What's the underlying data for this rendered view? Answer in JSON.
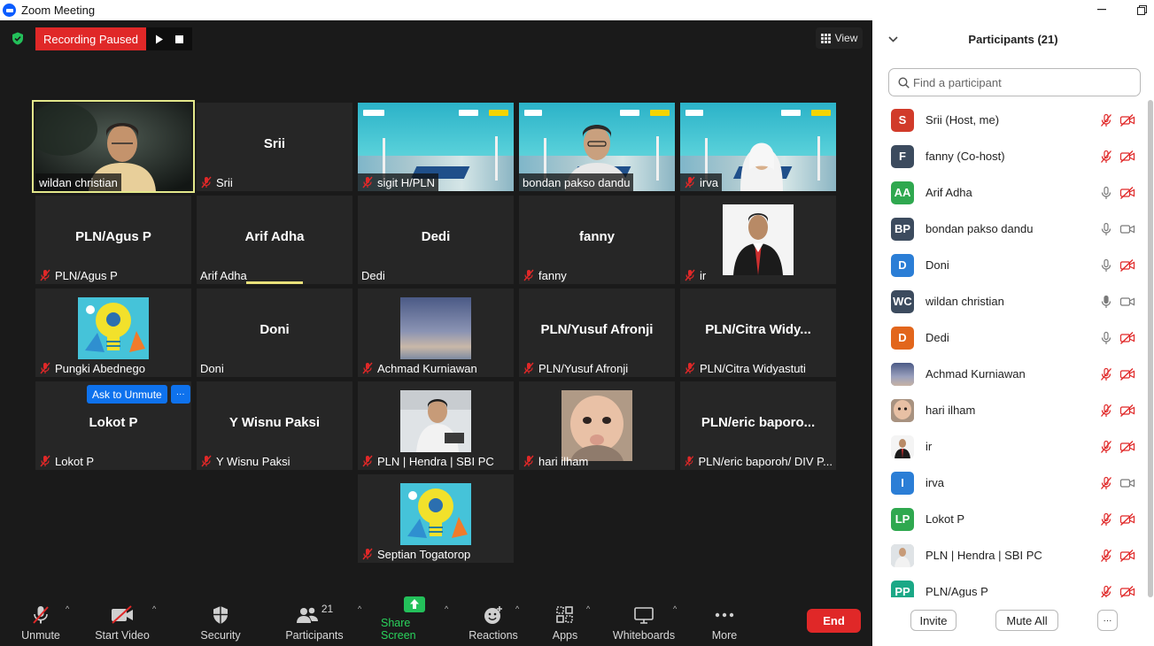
{
  "window": {
    "title": "Zoom Meeting"
  },
  "recording": {
    "label": "Recording Paused"
  },
  "view": {
    "label": "View"
  },
  "tiles": [
    {
      "name": "wildan christian",
      "muted": false,
      "kind": "video"
    },
    {
      "name": "Srii",
      "muted": true,
      "kind": "name",
      "center": "Srii"
    },
    {
      "name": "sigit H/PLN",
      "muted": true,
      "kind": "banner"
    },
    {
      "name": "bondan pakso dandu",
      "muted": false,
      "kind": "video-banner"
    },
    {
      "name": "irva",
      "muted": true,
      "kind": "video-banner2"
    },
    {
      "name": "PLN/Agus P",
      "muted": true,
      "kind": "name",
      "center": "PLN/Agus P"
    },
    {
      "name": "Arif Adha",
      "muted": false,
      "kind": "name",
      "center": "Arif Adha"
    },
    {
      "name": "Dedi",
      "muted": false,
      "kind": "name",
      "center": "Dedi"
    },
    {
      "name": "fanny",
      "muted": true,
      "kind": "name",
      "center": "fanny"
    },
    {
      "name": "ir",
      "muted": true,
      "kind": "photo-suit"
    },
    {
      "name": "Pungki Abednego",
      "muted": true,
      "kind": "photo-bulb"
    },
    {
      "name": "Doni",
      "muted": false,
      "kind": "name",
      "center": "Doni"
    },
    {
      "name": "Achmad Kurniawan",
      "muted": true,
      "kind": "photo-sky"
    },
    {
      "name": "PLN/Yusuf Afronji",
      "muted": true,
      "kind": "name",
      "center": "PLN/Yusuf Afronji"
    },
    {
      "name": "PLN/Citra Widyastuti",
      "muted": true,
      "kind": "name",
      "center": "PLN/Citra  Widy..."
    },
    {
      "name": "Lokot P",
      "muted": true,
      "kind": "name",
      "center": "Lokot P"
    },
    {
      "name": "Y Wisnu Paksi",
      "muted": true,
      "kind": "name",
      "center": "Y Wisnu Paksi"
    },
    {
      "name": "PLN | Hendra | SBI PC",
      "muted": true,
      "kind": "photo-man"
    },
    {
      "name": "hari ilham",
      "muted": true,
      "kind": "photo-baby"
    },
    {
      "name": "PLN/eric bароroh/ DIV P...",
      "muted": true,
      "kind": "name",
      "center": "PLN/eric  bароro..."
    },
    {
      "name": "Septian Togatorop",
      "muted": true,
      "kind": "photo-bulb"
    }
  ],
  "ask_unmute": {
    "label": "Ask to Unmute",
    "more": "···"
  },
  "toolbar": {
    "unmute": "Unmute",
    "start_video": "Start Video",
    "security": "Security",
    "participants": "Participants",
    "participants_count": "21",
    "share_screen": "Share Screen",
    "reactions": "Reactions",
    "apps": "Apps",
    "whiteboards": "Whiteboards",
    "more": "More",
    "end": "End"
  },
  "panel": {
    "title": "Participants (21)",
    "search_placeholder": "Find a participant",
    "invite": "Invite",
    "mute_all": "Mute All",
    "more": "···",
    "participants": [
      {
        "initials": "S",
        "color": "#d13b2a",
        "name": "Srii (Host, me)",
        "mic": "off",
        "cam": "off"
      },
      {
        "initials": "F",
        "color": "#3c4b5e",
        "name": "fanny (Co-host)",
        "mic": "off",
        "cam": "off"
      },
      {
        "initials": "AA",
        "color": "#2fa84f",
        "name": "Arif Adha",
        "mic": "on",
        "cam": "off"
      },
      {
        "initials": "BP",
        "color": "#3c4b5e",
        "name": "bondan pakso dandu",
        "mic": "on",
        "cam": "on"
      },
      {
        "initials": "D",
        "color": "#2b7ed6",
        "name": "Doni",
        "mic": "on",
        "cam": "off"
      },
      {
        "initials": "WC",
        "color": "#3c4b5e",
        "name": "wildan christian",
        "mic": "active",
        "cam": "on"
      },
      {
        "initials": "D",
        "color": "#e2661c",
        "name": "Dedi",
        "mic": "on",
        "cam": "off"
      },
      {
        "initials": "",
        "color": "#5a6a90",
        "name": "Achmad Kurniawan",
        "mic": "off",
        "cam": "off"
      },
      {
        "initials": "",
        "color": "#a08878",
        "name": "hari ilham",
        "mic": "off",
        "cam": "off"
      },
      {
        "initials": "",
        "color": "#ffffff",
        "name": "ir",
        "mic": "off",
        "cam": "off"
      },
      {
        "initials": "I",
        "color": "#2b7ed6",
        "name": "irva",
        "mic": "off",
        "cam": "on"
      },
      {
        "initials": "LP",
        "color": "#2fa84f",
        "name": "Lokot P",
        "mic": "off",
        "cam": "off"
      },
      {
        "initials": "",
        "color": "#c9c9c9",
        "name": "PLN | Hendra | SBI PC",
        "mic": "off",
        "cam": "off"
      },
      {
        "initials": "PP",
        "color": "#1ba886",
        "name": "PLN/Agus P",
        "mic": "off",
        "cam": "off"
      }
    ]
  }
}
